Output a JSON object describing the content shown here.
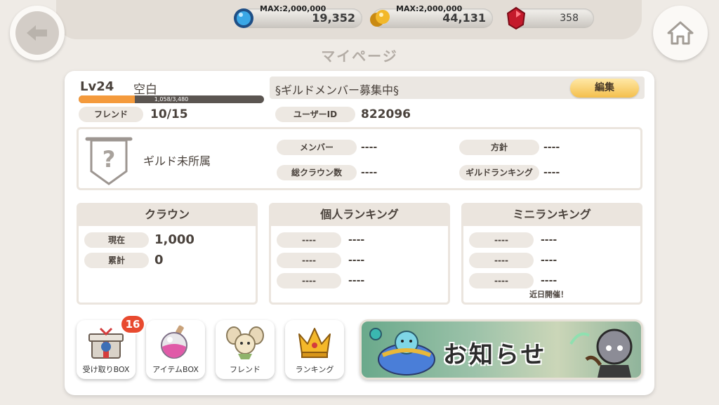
{
  "header": {
    "page_title": "マイページ",
    "currency_blue": {
      "max": "MAX:2,000,000",
      "value": "19,352"
    },
    "currency_gold": {
      "max": "MAX:2,000,000",
      "value": "44,131"
    },
    "currency_red": {
      "value": "358"
    }
  },
  "profile": {
    "level": "Lv24",
    "name": "空白",
    "xp_text": "1,058/3,480",
    "xp_fraction": 0.304,
    "friend_label": "フレンド",
    "friend_value": "10/15",
    "message": "§ギルドメンバー募集中§",
    "edit_label": "編集",
    "user_id_label": "ユーザーID",
    "user_id_value": "822096"
  },
  "guild": {
    "status": "ギルド未所属",
    "member_label": "メンバー",
    "member_value": "----",
    "policy_label": "方針",
    "policy_value": "----",
    "crowns_label": "総クラウン数",
    "crowns_value": "----",
    "ranking_label": "ギルドランキング",
    "ranking_value": "----"
  },
  "crown": {
    "title": "クラウン",
    "current_label": "現在",
    "current_value": "1,000",
    "total_label": "累計",
    "total_value": "0"
  },
  "personal_ranking": {
    "title": "個人ランキング",
    "rows": [
      {
        "label": "----",
        "value": "----"
      },
      {
        "label": "----",
        "value": "----"
      },
      {
        "label": "----",
        "value": "----"
      }
    ]
  },
  "mini_ranking": {
    "title": "ミニランキング",
    "rows": [
      {
        "label": "----",
        "value": "----"
      },
      {
        "label": "----",
        "value": "----"
      },
      {
        "label": "----",
        "value": "----"
      }
    ],
    "note": "近日開催！"
  },
  "bottom": {
    "receive_box": "受け取りBOX",
    "receive_badge": "16",
    "item_box": "アイテムBOX",
    "friend": "フレンド",
    "ranking": "ランキング",
    "notice": "お知らせ"
  },
  "colors": {
    "accent": "#f49a3c",
    "badge": "#e84a2f",
    "button": "#f4bf4c"
  }
}
